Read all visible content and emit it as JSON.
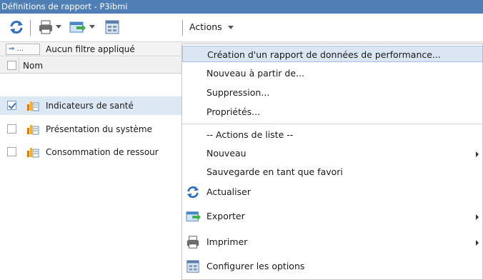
{
  "window": {
    "title": "Définitions de rapport - P3ibmi"
  },
  "toolbar": {
    "actions_label": "Actions",
    "icons": [
      "refresh-icon",
      "print-icon",
      "export-icon",
      "configure-icon"
    ]
  },
  "filter": {
    "button_label": "⇒ ...",
    "status": "Aucun filtre appliqué"
  },
  "table": {
    "header": "Nom",
    "rows": [
      {
        "label": "Indicateurs de santé",
        "checked": true
      },
      {
        "label": "Présentation du système",
        "checked": false
      },
      {
        "label": "Consommation de ressour",
        "checked": false
      }
    ]
  },
  "menu": {
    "items": [
      {
        "label": "Création d'un rapport de données de performance...",
        "highlight": true
      },
      {
        "label": "Nouveau à partir de..."
      },
      {
        "label": "Suppression..."
      },
      {
        "label": "Propriétés..."
      },
      {
        "label": "-- Actions de liste --"
      },
      {
        "label": "Nouveau",
        "submenu": true
      },
      {
        "label": "Sauvegarde en tant que favori"
      },
      {
        "label": "Actualiser",
        "icon": "refresh-icon"
      },
      {
        "label": "Exporter",
        "icon": "export-icon",
        "submenu": true
      },
      {
        "label": "Imprimer",
        "icon": "print-icon",
        "submenu": true
      },
      {
        "label": "Configurer les options",
        "icon": "configure-icon"
      }
    ]
  },
  "colors": {
    "titlebar": "#4f7fb5",
    "selection": "#dde8f5",
    "menu_highlight": "#dbe6f4"
  }
}
